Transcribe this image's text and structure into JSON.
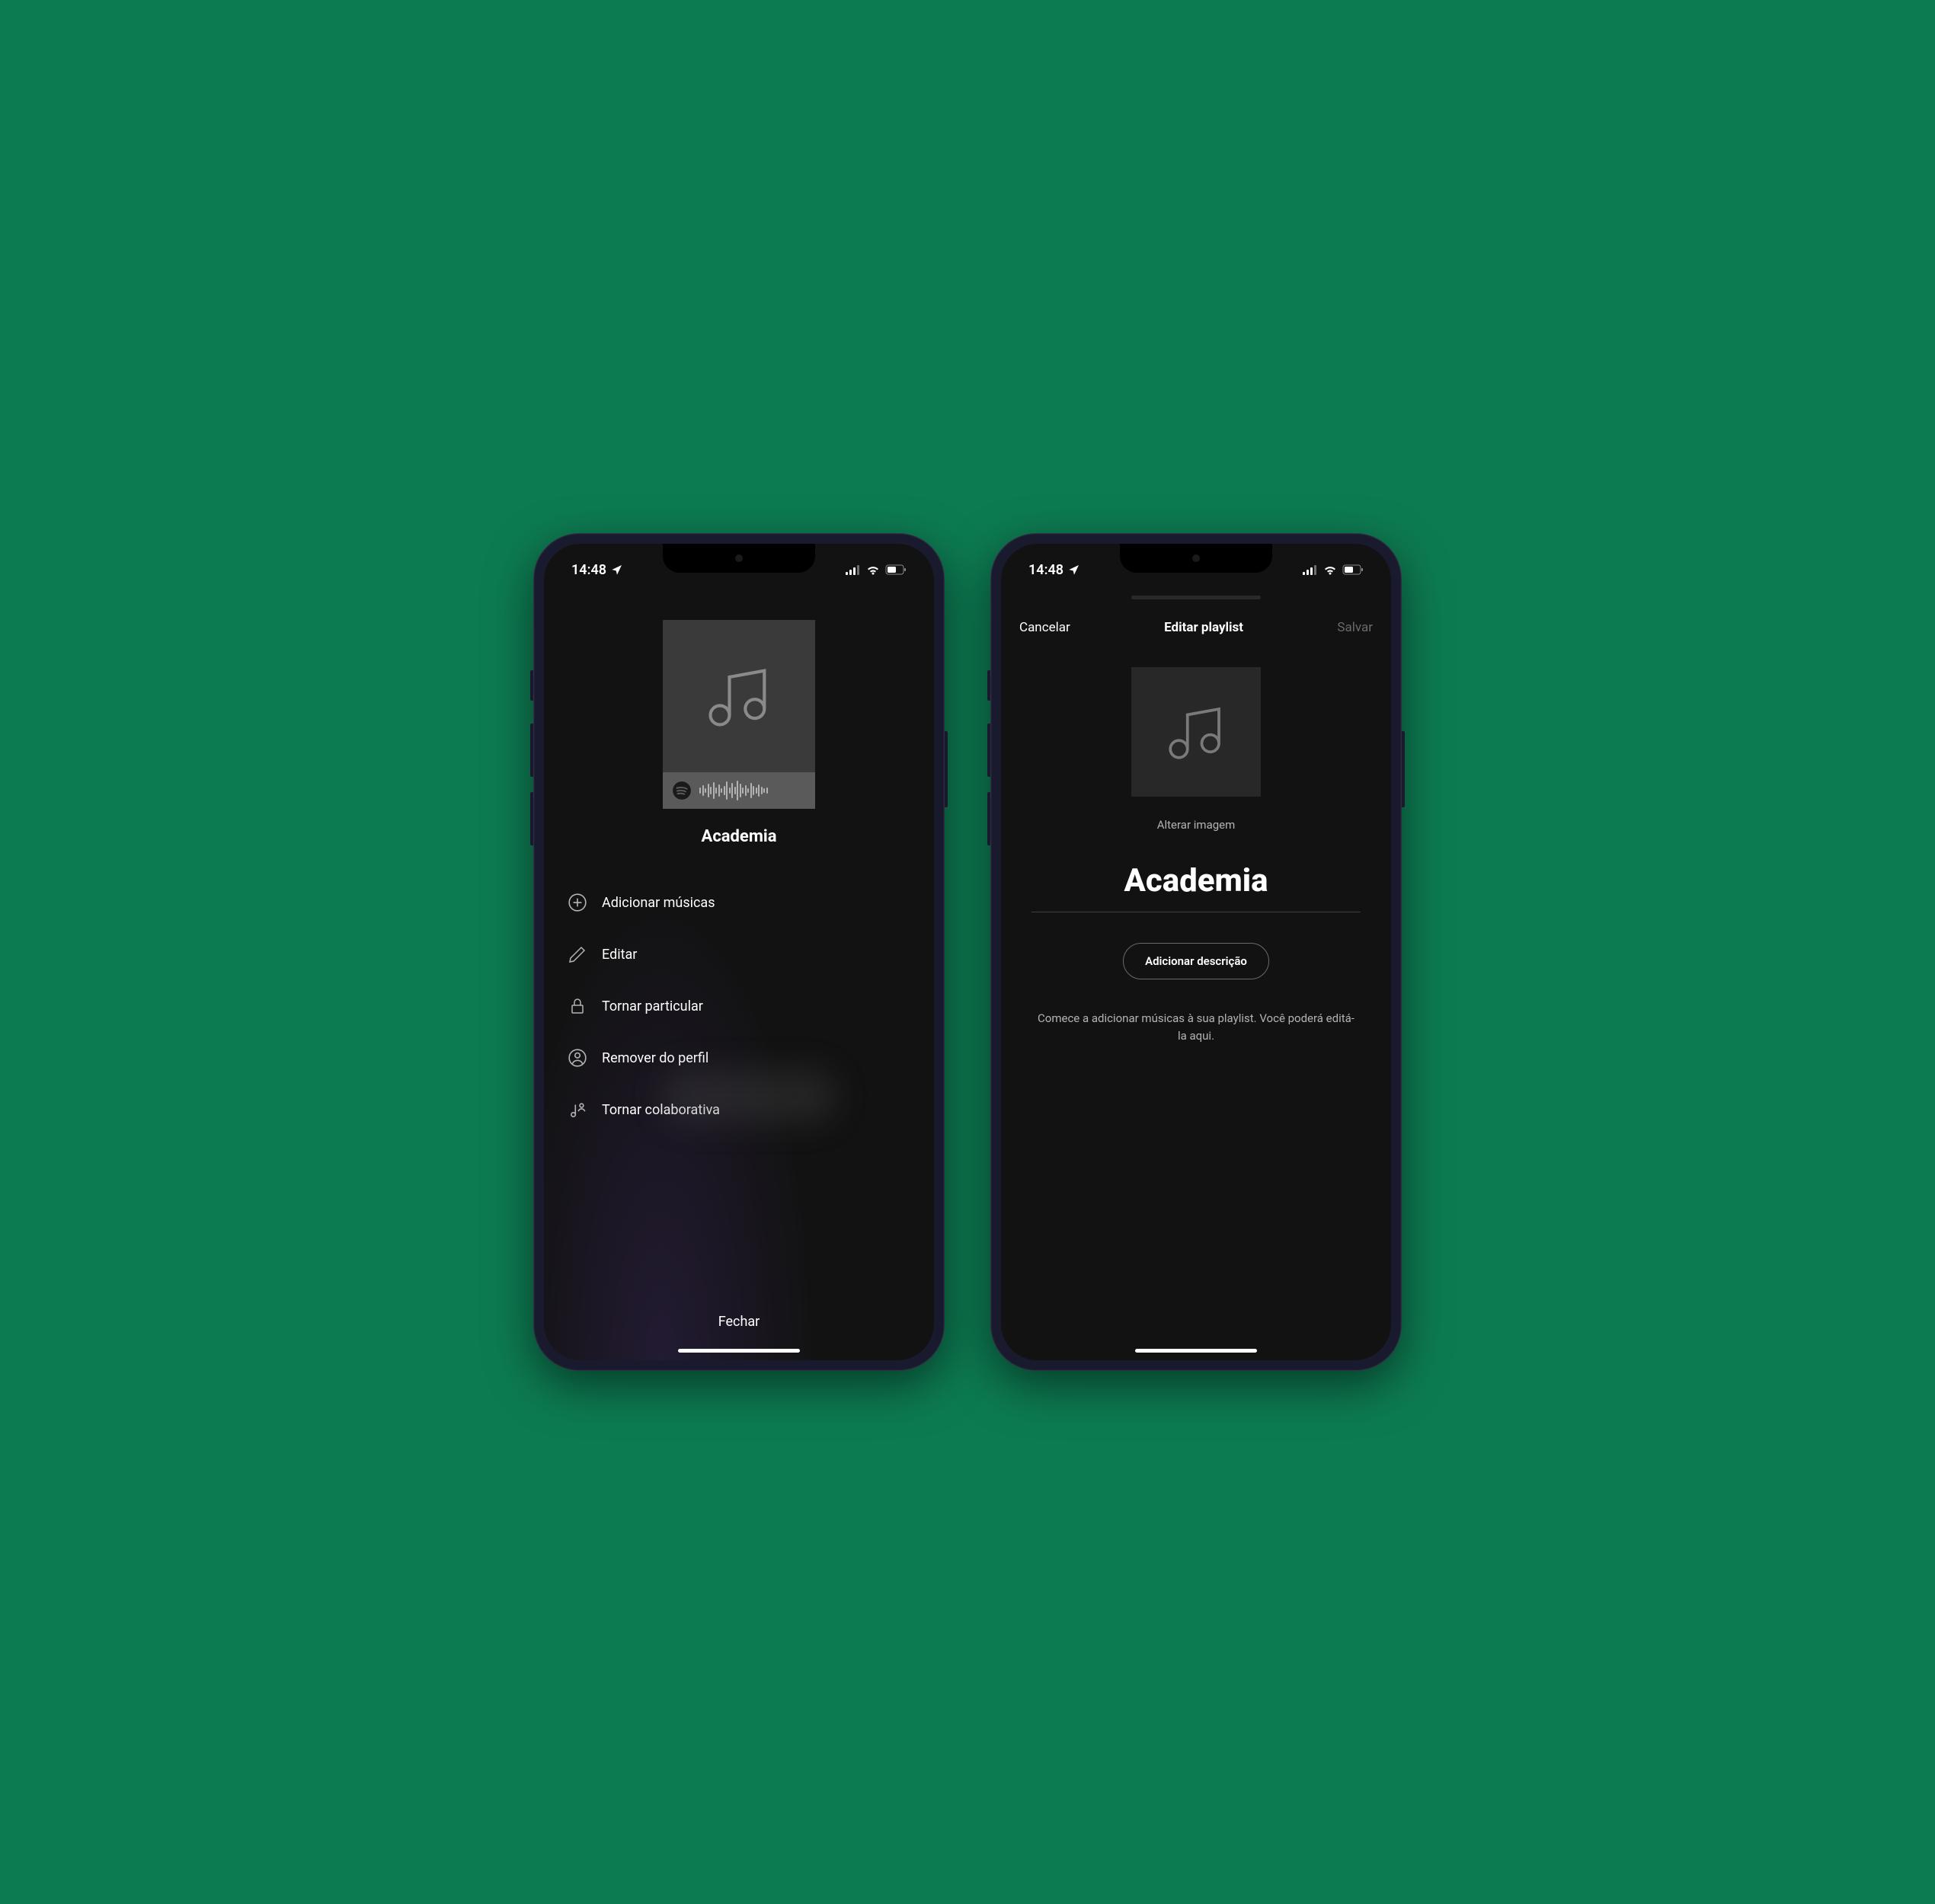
{
  "status": {
    "time": "14:48"
  },
  "screen1": {
    "playlist_title": "Academia",
    "menu": [
      {
        "label": "Adicionar músicas"
      },
      {
        "label": "Editar"
      },
      {
        "label": "Tornar particular"
      },
      {
        "label": "Remover do perfil"
      },
      {
        "label": "Tornar colaborativa"
      }
    ],
    "close_label": "Fechar"
  },
  "screen2": {
    "cancel_label": "Cancelar",
    "title": "Editar playlist",
    "save_label": "Salvar",
    "change_image_label": "Alterar imagem",
    "playlist_name": "Academia",
    "add_description_label": "Adicionar descrição",
    "help_text": "Comece a adicionar músicas à sua playlist. Você poderá editá-la aqui."
  }
}
